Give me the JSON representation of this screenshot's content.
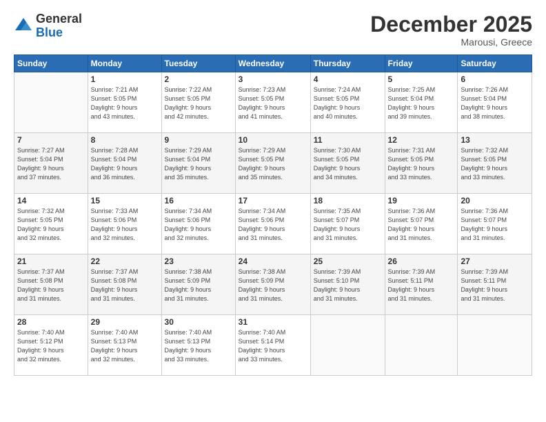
{
  "header": {
    "logo_general": "General",
    "logo_blue": "Blue",
    "month": "December 2025",
    "location": "Marousi, Greece"
  },
  "columns": [
    "Sunday",
    "Monday",
    "Tuesday",
    "Wednesday",
    "Thursday",
    "Friday",
    "Saturday"
  ],
  "weeks": [
    [
      {
        "day": "",
        "detail": ""
      },
      {
        "day": "1",
        "detail": "Sunrise: 7:21 AM\nSunset: 5:05 PM\nDaylight: 9 hours\nand 43 minutes."
      },
      {
        "day": "2",
        "detail": "Sunrise: 7:22 AM\nSunset: 5:05 PM\nDaylight: 9 hours\nand 42 minutes."
      },
      {
        "day": "3",
        "detail": "Sunrise: 7:23 AM\nSunset: 5:05 PM\nDaylight: 9 hours\nand 41 minutes."
      },
      {
        "day": "4",
        "detail": "Sunrise: 7:24 AM\nSunset: 5:05 PM\nDaylight: 9 hours\nand 40 minutes."
      },
      {
        "day": "5",
        "detail": "Sunrise: 7:25 AM\nSunset: 5:04 PM\nDaylight: 9 hours\nand 39 minutes."
      },
      {
        "day": "6",
        "detail": "Sunrise: 7:26 AM\nSunset: 5:04 PM\nDaylight: 9 hours\nand 38 minutes."
      }
    ],
    [
      {
        "day": "7",
        "detail": "Sunrise: 7:27 AM\nSunset: 5:04 PM\nDaylight: 9 hours\nand 37 minutes."
      },
      {
        "day": "8",
        "detail": "Sunrise: 7:28 AM\nSunset: 5:04 PM\nDaylight: 9 hours\nand 36 minutes."
      },
      {
        "day": "9",
        "detail": "Sunrise: 7:29 AM\nSunset: 5:04 PM\nDaylight: 9 hours\nand 35 minutes."
      },
      {
        "day": "10",
        "detail": "Sunrise: 7:29 AM\nSunset: 5:05 PM\nDaylight: 9 hours\nand 35 minutes."
      },
      {
        "day": "11",
        "detail": "Sunrise: 7:30 AM\nSunset: 5:05 PM\nDaylight: 9 hours\nand 34 minutes."
      },
      {
        "day": "12",
        "detail": "Sunrise: 7:31 AM\nSunset: 5:05 PM\nDaylight: 9 hours\nand 33 minutes."
      },
      {
        "day": "13",
        "detail": "Sunrise: 7:32 AM\nSunset: 5:05 PM\nDaylight: 9 hours\nand 33 minutes."
      }
    ],
    [
      {
        "day": "14",
        "detail": "Sunrise: 7:32 AM\nSunset: 5:05 PM\nDaylight: 9 hours\nand 32 minutes."
      },
      {
        "day": "15",
        "detail": "Sunrise: 7:33 AM\nSunset: 5:06 PM\nDaylight: 9 hours\nand 32 minutes."
      },
      {
        "day": "16",
        "detail": "Sunrise: 7:34 AM\nSunset: 5:06 PM\nDaylight: 9 hours\nand 32 minutes."
      },
      {
        "day": "17",
        "detail": "Sunrise: 7:34 AM\nSunset: 5:06 PM\nDaylight: 9 hours\nand 31 minutes."
      },
      {
        "day": "18",
        "detail": "Sunrise: 7:35 AM\nSunset: 5:07 PM\nDaylight: 9 hours\nand 31 minutes."
      },
      {
        "day": "19",
        "detail": "Sunrise: 7:36 AM\nSunset: 5:07 PM\nDaylight: 9 hours\nand 31 minutes."
      },
      {
        "day": "20",
        "detail": "Sunrise: 7:36 AM\nSunset: 5:07 PM\nDaylight: 9 hours\nand 31 minutes."
      }
    ],
    [
      {
        "day": "21",
        "detail": "Sunrise: 7:37 AM\nSunset: 5:08 PM\nDaylight: 9 hours\nand 31 minutes."
      },
      {
        "day": "22",
        "detail": "Sunrise: 7:37 AM\nSunset: 5:08 PM\nDaylight: 9 hours\nand 31 minutes."
      },
      {
        "day": "23",
        "detail": "Sunrise: 7:38 AM\nSunset: 5:09 PM\nDaylight: 9 hours\nand 31 minutes."
      },
      {
        "day": "24",
        "detail": "Sunrise: 7:38 AM\nSunset: 5:09 PM\nDaylight: 9 hours\nand 31 minutes."
      },
      {
        "day": "25",
        "detail": "Sunrise: 7:39 AM\nSunset: 5:10 PM\nDaylight: 9 hours\nand 31 minutes."
      },
      {
        "day": "26",
        "detail": "Sunrise: 7:39 AM\nSunset: 5:11 PM\nDaylight: 9 hours\nand 31 minutes."
      },
      {
        "day": "27",
        "detail": "Sunrise: 7:39 AM\nSunset: 5:11 PM\nDaylight: 9 hours\nand 31 minutes."
      }
    ],
    [
      {
        "day": "28",
        "detail": "Sunrise: 7:40 AM\nSunset: 5:12 PM\nDaylight: 9 hours\nand 32 minutes."
      },
      {
        "day": "29",
        "detail": "Sunrise: 7:40 AM\nSunset: 5:13 PM\nDaylight: 9 hours\nand 32 minutes."
      },
      {
        "day": "30",
        "detail": "Sunrise: 7:40 AM\nSunset: 5:13 PM\nDaylight: 9 hours\nand 33 minutes."
      },
      {
        "day": "31",
        "detail": "Sunrise: 7:40 AM\nSunset: 5:14 PM\nDaylight: 9 hours\nand 33 minutes."
      },
      {
        "day": "",
        "detail": ""
      },
      {
        "day": "",
        "detail": ""
      },
      {
        "day": "",
        "detail": ""
      }
    ]
  ]
}
